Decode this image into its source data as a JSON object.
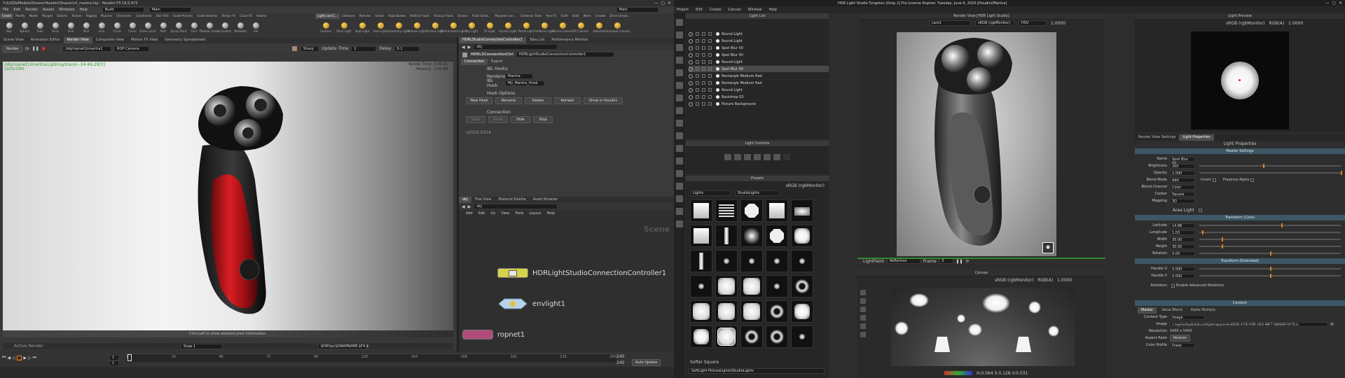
{
  "houdini": {
    "title": "Y:/LUIZA/Models/Shaver/Houdini/Shaver/v5_mantra.hip - Houdini FX 16.5.473",
    "menu": [
      "File",
      "Edit",
      "Render",
      "Assets",
      "Windows",
      "Help"
    ],
    "build": "Build",
    "main": "Main",
    "shelf_tabs_left": [
      "Create",
      "Modify",
      "Model",
      "Polygon",
      "Deform",
      "Texture",
      "Rigging",
      "Muscles",
      "Characters",
      "Constraints",
      "Hair Utils",
      "Guide Process",
      "Guide Brushes",
      "Terrain FX",
      "Cloud FX",
      "Volume"
    ],
    "shelf_items_left": [
      "Box",
      "Sphere",
      "Tube",
      "Torus",
      "Grid",
      "Null",
      "Line",
      "Circle",
      "Curve",
      "Draw Curve",
      "Path",
      "Spray Paint",
      "Font",
      "Platonic Solids",
      "L-System",
      "Metaball",
      "File"
    ],
    "shelf_tabs_right": [
      "Lights and C...",
      "Collisions",
      "Particles",
      "Grains",
      "Rigid Bodies",
      "Particle Fluids",
      "Viscous Fluids",
      "Oceans",
      "Fluid Conta...",
      "Populate Con...",
      "Container Tools",
      "Pyro FX",
      "Cloth",
      "Solid",
      "Wires",
      "Crowds",
      "Drive Simula..."
    ],
    "shelf_items_right": [
      "Camera",
      "Point Light",
      "Spot Light",
      "Area Light",
      "Geometry Light",
      "Volume Light",
      "Distant Light",
      "Environment Light",
      "Sky Light",
      "GI Light",
      "Caustic Light",
      "Portal Light",
      "Ambient Light",
      "Stereo Camera",
      "VR Camera",
      "Switcher",
      "Gamepad Camera"
    ],
    "pane_tabs_left": [
      "Scene View",
      "Animation Editor",
      "Render View",
      "Composite View",
      "Motion FX View",
      "Geometry Spreadsheet"
    ],
    "render_btn": "Render",
    "render_path": "/obj/ropnet1/mantra1",
    "camera": "ROP Camera",
    "snap_label": "Sharp",
    "update_time_label": "Update Time",
    "update_time": "1",
    "delay_label": "Delay",
    "delay": "0.1",
    "viewport_path": "/obj/ropnet1/mantra1(pbrraytrace)--14:46:29[3]",
    "viewport_sub": "1920x1080",
    "render_time_label": "Render Time:",
    "render_time": "0:00:25",
    "memory_label": "Memory:",
    "memory": "3.04 GB",
    "viewport_hint": "Ctrl+Left to show detailed pixel information.",
    "active_render": "Active Render",
    "snap_field": "Snap 1",
    "snapname": "$HIP/ipr/$SNAPNAME.$F4.$",
    "frame_current": "1",
    "frame_start": "1",
    "frame_end": "240",
    "frame_end2": "240",
    "timeline_ticks": [
      "1",
      "24",
      "48",
      "72",
      "96",
      "120",
      "144",
      "168",
      "192",
      "216",
      "240"
    ],
    "auto_update": "Auto Update",
    "param_tabs": [
      "HDRLStudioConnectionController1",
      "Take List",
      "Performance Monitor"
    ],
    "param_path": "obj",
    "param_node_type": "HDRLSConnectionCtrl",
    "param_node_name": "HDRLightStudioConnectionController1",
    "param_subtabs": [
      "Connection",
      "Export"
    ],
    "ibl_hooks": "IBL Hooks",
    "renderer_label": "Renderer",
    "renderer": "Mantra",
    "ibl_hook_label": "IBL Hook",
    "ibl_hook": "My_Mantra_Hook",
    "hook_options": "Hook Options",
    "hook_buttons": [
      "New Hook",
      "Rename",
      "Delete",
      "Refresh",
      "Show in Houdini"
    ],
    "connection": "Connection",
    "conn_buttons": [
      "Start",
      "Show",
      "Hide",
      "Stop"
    ],
    "version": "v2019.0314",
    "net_tabs": [
      "obj",
      "Tree View",
      "Material Palette",
      "Asset Browser"
    ],
    "net_path": "obj",
    "net_menu": [
      "Add",
      "Edit",
      "Go",
      "View",
      "Tools",
      "Layout",
      "Help"
    ],
    "net_scene": "Scene",
    "nodes": [
      "HDRLightStudioConnectionController1",
      "envlight1",
      "ropnet1"
    ]
  },
  "hdrls": {
    "title": "HDR Light Studio Tungsten [Drop 2] Pro License Expires: Tuesday, June 9, 2020 [Houdini/Mantra]",
    "menu": [
      "Project",
      "Edit",
      "Create",
      "Canvas",
      "Window",
      "Help"
    ],
    "light_list_title": "Light List",
    "lights": [
      "Round Light",
      "Round Light",
      "Spot Blur 50",
      "Spot Blur 50",
      "Round Light",
      "Spot Blur 50",
      "Rectangle Medium Rad",
      "Rectangle Medium Rad",
      "Round Light",
      "Backdrop 03",
      "Picture Background"
    ],
    "selected_index": 5,
    "light_controls_title": "Light Controls",
    "presets_title": "Presets",
    "presets_colorspace": "sRGB (rgbMonitor)",
    "presets_filter1": "Lights",
    "presets_filter2": "StudioLights",
    "preset_selected": "Softer Square",
    "preset_path": "SoftLight PictureLights\\StudioLights",
    "render_view_title": "Render View [HDR Light Studio]",
    "render_cam": "cam1",
    "render_cs": "sRGB (rgbMonitor)",
    "render_mode": "HSV",
    "render_exposure": "1.0000",
    "lightpaint_label": "LightPaint",
    "lightpaint_mode": "Reflection",
    "frame_label": "Frame",
    "frame": "0",
    "canvas_title": "Canvas",
    "canvas_cs": "sRGB (rgbMonitor)",
    "canvas_ch": "RGB(A)",
    "canvas_exposure": "1.0000",
    "canvas_status": "H:0.064 S:0.128 V:0.031",
    "light_preview_title": "Light Preview",
    "preview_cs": "sRGB (rgbMonitor)",
    "preview_ch": "RGB(A)",
    "preview_exposure": "1.0000",
    "prop_tabs": [
      "Render View Settings",
      "Light Properties"
    ],
    "light_properties": "Light Properties",
    "master_settings": "Master Settings",
    "props": [
      {
        "label": "Name",
        "value": "Spot Blur 50"
      },
      {
        "label": "Brightness",
        "value": "200",
        "slider": 0.45
      },
      {
        "label": "Opacity",
        "value": "1.000",
        "slider": 1.0
      },
      {
        "label": "Blend Mode",
        "value": "Add",
        "extra": "Invert",
        "extra2": "Preserve Alpha"
      },
      {
        "label": "Blend Channel",
        "value": "Color"
      },
      {
        "label": "Cooker",
        "value": "Square"
      },
      {
        "label": "Mapping",
        "value": "3D"
      }
    ],
    "area_light": "Area Light",
    "transform_core": "Transform (Core)",
    "core_props": [
      {
        "label": "Latitude",
        "value": "14.88",
        "slider": 0.58
      },
      {
        "label": "Longitude",
        "value": "1.03",
        "slider": 0.02
      },
      {
        "label": "Width",
        "value": "30.00",
        "slider": 0.16
      },
      {
        "label": "Height",
        "value": "30.00",
        "slider": 0.16
      },
      {
        "label": "Rotation",
        "value": "0.00",
        "slider": 0.5
      }
    ],
    "transform_ext": "Transform (Extended)",
    "ext_props": [
      {
        "label": "Handle U",
        "value": "0.000",
        "slider": 0.5
      },
      {
        "label": "Handle V",
        "value": "0.000",
        "slider": 0.5
      }
    ],
    "rotations_label": "Rotations",
    "adv_rotations": "Enable Advanced Rotations",
    "content": "Content",
    "content_tabs": [
      "Master",
      "Value Blend",
      "Alpha Multiply"
    ],
    "content_type_label": "Content Type",
    "content_type": "Image",
    "image_label": "Image",
    "image_path": "c:/sophie/AppData/Local/lightmap/presets/DEAD A73E-0766-10E2-9BF7-5SBA69A74F7D.tx",
    "resolution_label": "Resolution",
    "resolution": "5400 x 5400",
    "aspect_label": "Aspect Ratio",
    "aspect_btn": "Restore",
    "color_profile_label": "Color Profile",
    "color_profile": "linear"
  },
  "colors": {
    "accent_orange": "#e08020",
    "section_blue": "#3c5866",
    "shaver_red": "#c8161c"
  }
}
